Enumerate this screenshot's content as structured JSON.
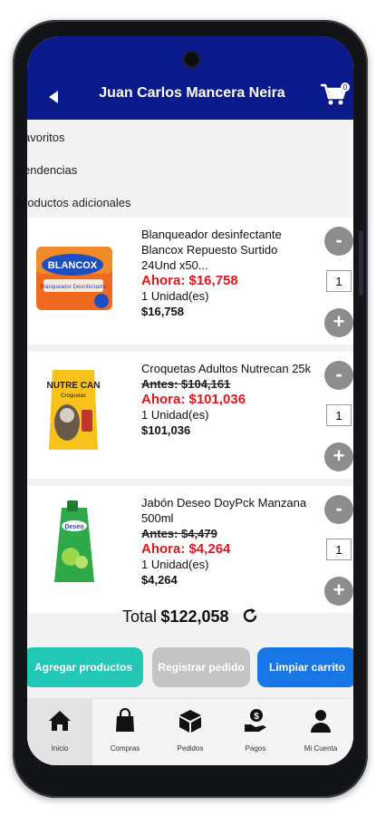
{
  "header": {
    "title": "Juan Carlos Mancera Neira",
    "cart_count": "0"
  },
  "menu": [
    "avoritos",
    "endencias",
    "roductos adicionales"
  ],
  "products": [
    {
      "name": "Blanqueador desinfectante Blancox Repuesto Surtido 24Und x50...",
      "before": "",
      "now": "Ahora: $16,758",
      "unit": "1 Unidad(es)",
      "price": "$16,758",
      "qty": "1",
      "image_brand": "BLANCOX",
      "image_sub": "Blanqueador Desinfectante"
    },
    {
      "name": "Croquetas Adultos Nutrecan 25k",
      "before": "Antes: $104,161",
      "now": "Ahora: $101,036",
      "unit": "1 Unidad(es)",
      "price": "$101,036",
      "qty": "1",
      "image_brand": "NUTRE CAN",
      "image_sub": "Croquetas"
    },
    {
      "name": "Jabón Deseo DoyPck Manzana 500ml",
      "before": "Antes: $4,479",
      "now": "Ahora: $4,264",
      "unit": "1 Unidad(es)",
      "price": "$4,264",
      "qty": "1",
      "image_brand": "Deseo",
      "image_sub": ""
    }
  ],
  "minus_label": "-",
  "plus_label": "+",
  "total": {
    "label": "Total",
    "value": "$122,058"
  },
  "actions": {
    "add": "Agregar productos",
    "register": "Registrar pedido",
    "clear": "Limpiar carrito"
  },
  "nav": [
    {
      "label": "Inicio",
      "icon": "home-icon"
    },
    {
      "label": "Compras",
      "icon": "shopping-bag-icon"
    },
    {
      "label": "Pedidos",
      "icon": "box-icon"
    },
    {
      "label": "Pagos",
      "icon": "payment-hand-icon"
    },
    {
      "label": "Mi Cuenta",
      "icon": "user-icon"
    }
  ],
  "colors": {
    "header": "#0a1a8a",
    "price_now": "#e0161d",
    "add": "#22c7b5",
    "register": "#c4c4c4",
    "clear": "#1976e6"
  }
}
